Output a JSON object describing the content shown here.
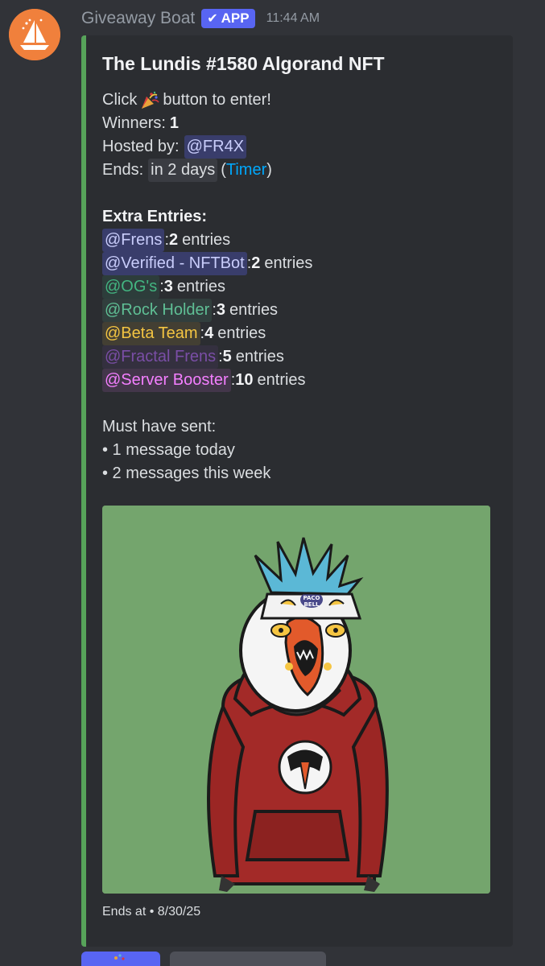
{
  "message": {
    "author": "Giveaway Boat",
    "badge": "APP",
    "timestamp": "11:44 AM"
  },
  "embed": {
    "accent_color": "#57a35a",
    "title": "The Lundis #1580 Algorand NFT",
    "click_prefix": "Click",
    "click_suffix": "button to enter!",
    "winners_label": "Winners:",
    "winners_value": "1",
    "hosted_label": "Hosted by:",
    "host": "@FR4X",
    "ends_label": "Ends:",
    "ends_relative": "in 2 days",
    "timer_open": "(",
    "timer_link": "Timer",
    "timer_close": ")",
    "extra_heading": "Extra Entries:",
    "extra_entries": [
      {
        "role": "@Frens",
        "count": "2",
        "unit": "entries",
        "color": "#c9cdfb",
        "bg": "rgba(88,101,242,0.3)"
      },
      {
        "role": "@Verified - NFTBot",
        "count": "2",
        "unit": "entries",
        "color": "#c9cdfb",
        "bg": "rgba(88,101,242,0.3)"
      },
      {
        "role": "@OG's",
        "count": "3",
        "unit": "entries",
        "color": "#43b581",
        "bg": "rgba(67,181,129,0.12)"
      },
      {
        "role": "@Rock Holder",
        "count": "3",
        "unit": "entries",
        "color": "#5fbf95",
        "bg": "rgba(95,191,149,0.12)"
      },
      {
        "role": "@Beta Team",
        "count": "4",
        "unit": "entries",
        "color": "#f4c542",
        "bg": "rgba(244,197,66,0.12)"
      },
      {
        "role": "@Fractal Frens",
        "count": "5",
        "unit": "entries",
        "color": "#7a4ea6",
        "bg": "rgba(122,78,166,0.12)"
      },
      {
        "role": "@Server Booster",
        "count": "10",
        "unit": "entries",
        "color": "#f47fff",
        "bg": "rgba(244,127,255,0.12)"
      }
    ],
    "requirements_heading": "Must have sent:",
    "requirements": [
      "• 1 message today",
      "• 2 messages this week"
    ],
    "image_bg": "#74a56d",
    "hat_text_1": "PACO",
    "hat_text_2": "BELL",
    "footer": "Ends at • 8/30/25"
  },
  "buttons": {
    "enter_icon": "party-popper-icon",
    "enter_color": "#5865f2",
    "secondary_color": "#4e5058"
  }
}
